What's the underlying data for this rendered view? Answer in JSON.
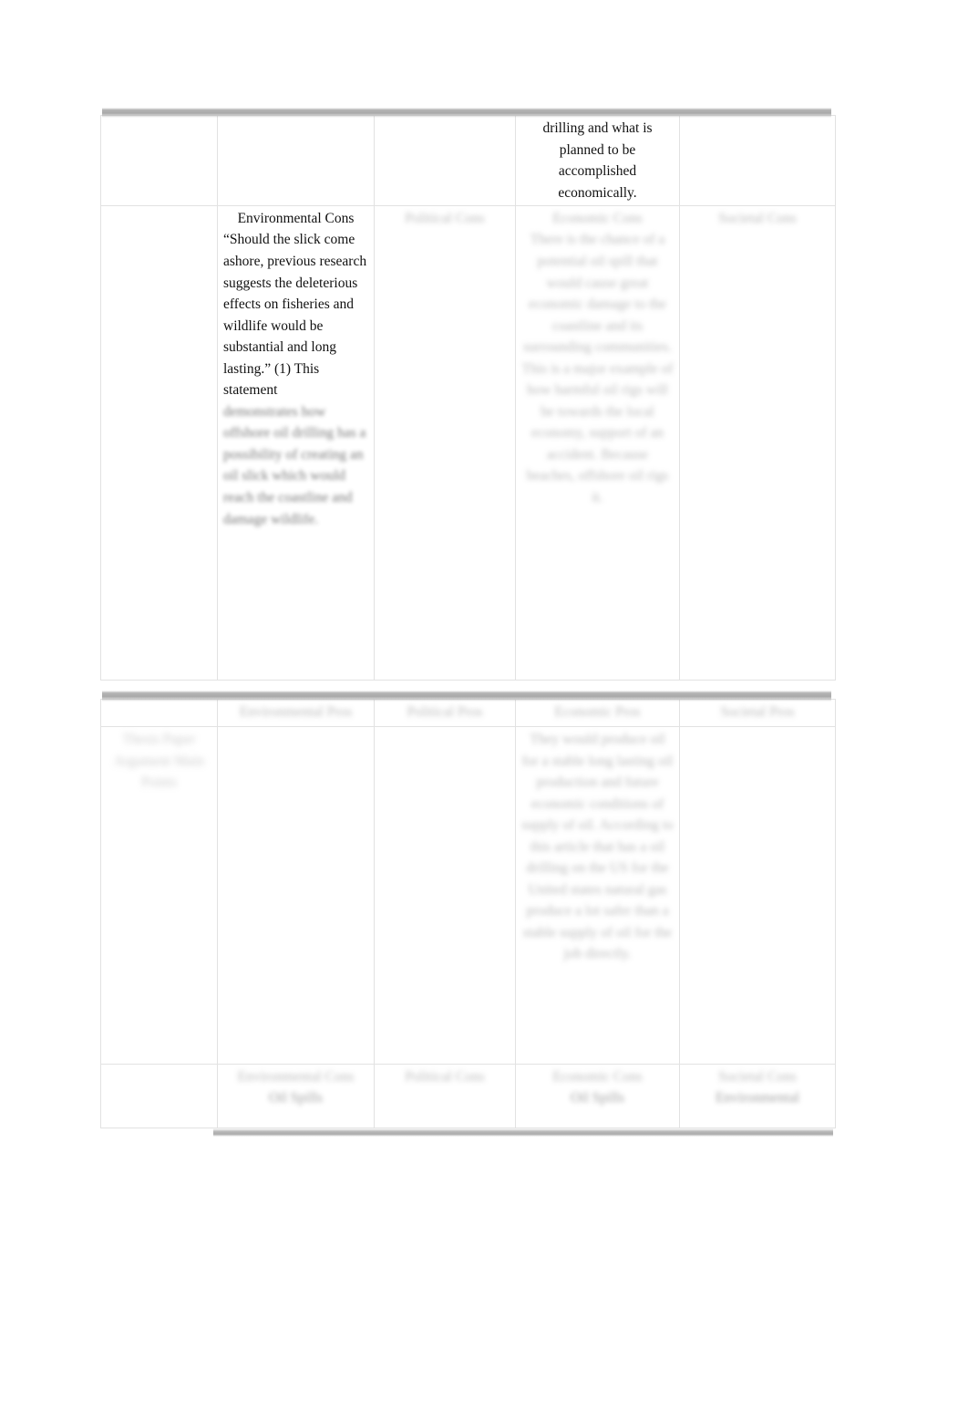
{
  "document": {
    "type": "word-processor-page",
    "page_background": "#ffffff",
    "text_color": "#000000",
    "border_color": "#e2e2e2",
    "break_band_color": "#b0b0b0"
  },
  "table_top": {
    "row_continued": {
      "col1": "",
      "col2": "",
      "col3": "",
      "col4": "drilling and what is planned to be accomplished economically.",
      "col5": ""
    },
    "row_main": {
      "col1": "",
      "col2_heading": "Environmental Cons",
      "col2_body": "“Should the slick come ashore, previous research suggests the deleterious effects on fisheries and wildlife would be substantial and long lasting.” (1) This statement",
      "col2_body_blurred": "demonstrates how offshore oil drilling has a possibility of creating an oil slick which would reach the coastline and damage wildlife.",
      "col3_heading": "Political Cons",
      "col3_body_blurred": "",
      "col4_heading": "Economic Cons",
      "col4_body_blurred": "There is the chance of a potential oil spill that would cause great economic damage to the coastline and its surrounding communities. This is a major example of how harmful oil rigs will be towards the local economy, support of an accident. Because beaches, offshore oil rigs it.",
      "col5_heading": "Societal Cons",
      "col5_body_blurred": ""
    }
  },
  "table_bottom": {
    "row_headers": {
      "col1": "",
      "col2": "Environmental Pros",
      "col3": "Political Pros",
      "col4": "Economic Pros",
      "col5": "Societal Pros"
    },
    "row_body": {
      "col1_blurred": "Thesis Paper Argument Main Points",
      "col2_blurred": "",
      "col3_blurred": "",
      "col4_blurred": "They would produce oil for a stable long lasting oil production and future economic conditions of supply of oil. According to this article that has a oil drilling on the US for the United states natural gas produce a lot safer than a stable supply of oil for the job directly.",
      "col5_blurred": ""
    },
    "row_footer": {
      "col1": "",
      "col2_heading": "Environmental Cons",
      "col2_sub": "Oil Spills",
      "col3_heading": "Political Cons",
      "col3_sub": "",
      "col4_heading": "Economic Cons",
      "col4_sub": "Oil Spills",
      "col5_heading": "Societal Cons",
      "col5_sub": "Environmental"
    }
  }
}
